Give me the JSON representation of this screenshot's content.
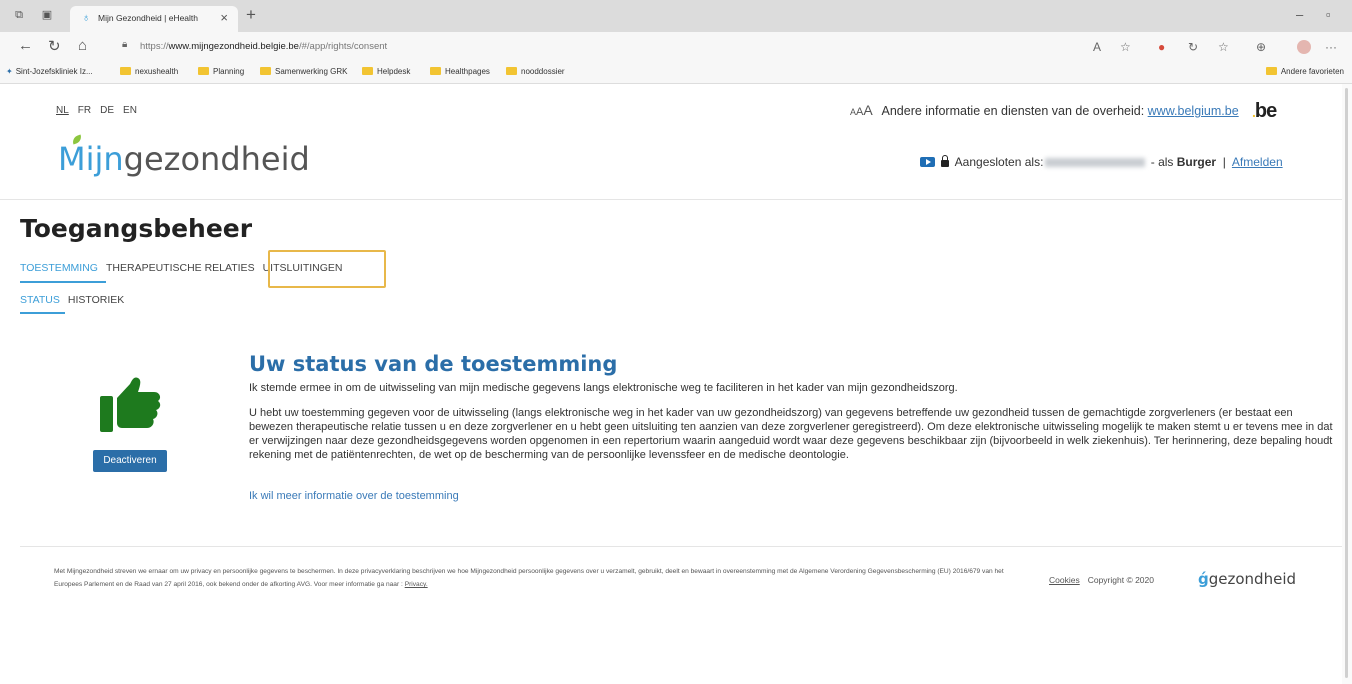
{
  "browser": {
    "tab_title": "Mijn Gezondheid | eHealth",
    "new_tab": "+",
    "url_prefix": "https://",
    "url_host": "www.mijngezondheid.belgie.be",
    "url_path": "/#/app/rights/consent",
    "bookmarks": [
      {
        "label": "Sint-Jozefskliniek Iz..."
      },
      {
        "label": "nexushealth"
      },
      {
        "label": "Planning"
      },
      {
        "label": "Samenwerking GRK"
      },
      {
        "label": "Helpdesk"
      },
      {
        "label": "Healthpages"
      },
      {
        "label": "nooddossier"
      }
    ],
    "other_favorites": "Andere favorieten"
  },
  "header": {
    "languages": [
      "NL",
      "FR",
      "DE",
      "EN"
    ],
    "font_sizes": [
      "A",
      "A",
      "A"
    ],
    "gov_info_text": "Andere informatie en diensten van de overheid:",
    "gov_link": "www.belgium.be",
    "be_logo": "be",
    "logo_part1": "Mijn",
    "logo_part2": "gezondheid",
    "connected_label": "Aangesloten als:",
    "role_prefix": "- als",
    "role": "Burger",
    "separator": "|",
    "logout": "Afmelden"
  },
  "main": {
    "title": "Toegangsbeheer",
    "tabs": [
      {
        "label": "TOESTEMMING",
        "active": true
      },
      {
        "label": "THERAPEUTISCHE RELATIES",
        "active": false
      },
      {
        "label": "UITSLUITINGEN",
        "active": false
      }
    ],
    "subtabs": [
      {
        "label": "STATUS",
        "active": true
      },
      {
        "label": "HISTORIEK",
        "active": false
      }
    ],
    "status_heading": "Uw status van de toestemming",
    "status_line": "Ik stemde ermee in om de uitwisseling van mijn medische gegevens langs elektronische weg te faciliteren in het kader van mijn gezondheidszorg.",
    "status_body": "U hebt uw toestemming gegeven voor de uitwisseling (langs elektronische weg in het kader van uw gezondheidszorg) van gegevens betreffende uw gezondheid tussen de gemachtigde zorgverleners (er bestaat een bewezen therapeutische relatie tussen u en deze zorgverlener en u hebt geen uitsluiting ten aanzien van deze zorgverlener geregistreerd). Om deze elektronische uitwisseling mogelijk te maken stemt u er tevens mee in dat er verwijzingen naar deze gezondheidsgegevens worden opgenomen in een repertorium waarin aangeduid wordt waar deze gegevens beschikbaar zijn (bijvoorbeeld in welk ziekenhuis). Ter herinnering, deze bepaling houdt rekening met de patiëntenrechten, de wet op de bescherming van de persoonlijke levenssfeer en de medische deontologie.",
    "more_info_link": "Ik wil meer informatie over de toestemming",
    "deactivate_button": "Deactiveren",
    "status_icon": "thumbs-up-icon",
    "icon_color": "#1e7a1e"
  },
  "footer": {
    "privacy_text": "Met Mijngezondheid streven we ernaar om uw privacy en persoonlijke gegevens te beschermen. In deze privacyverklaring beschrijven we hoe Mijngezondheid persoonlijke gegevens over u verzamelt, gebruikt, deelt en bewaart in overeenstemming met de Algemene Verordening Gegevensbescherming (EU) 2016/679 van het Europees Parlement en de Raad van 27 april 2016, ook bekend onder de afkorting AVG. Voor meer informatie ga naar :",
    "privacy_link": "Privacy.",
    "cookies": "Cookies",
    "copyright": "Copyright © 2020",
    "logo_text": "gezondheid"
  },
  "colors": {
    "accent": "#3c9ed8",
    "button": "#2b6ea8",
    "highlight": "#e8b84a"
  }
}
